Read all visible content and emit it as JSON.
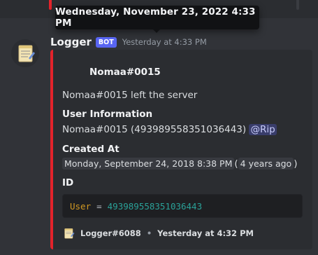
{
  "tooltip": {
    "text": "Wednesday, November 23, 2022 4:33 PM"
  },
  "message": {
    "author": "Logger",
    "bot_tag": "BOT",
    "timestamp": "Yesterday at 4:33 PM",
    "avatar_icon": "notepad-icon"
  },
  "embed": {
    "accent_color": "#e3232b",
    "author": "Nomaa#0015",
    "description": "Nomaa#0015 left the server",
    "fields": [
      {
        "name": "User Information",
        "value_text": "Nomaa#0015 (493989558351036443)",
        "mention": "@Rip"
      },
      {
        "name": "Created At",
        "date": "Monday, September 24, 2018 8:38 PM",
        "relative_open": "(",
        "relative": "4 years ago",
        "relative_close": ")"
      },
      {
        "name": "ID",
        "code_key": "User",
        "code_op": "=",
        "code_value": "493989558351036443"
      }
    ],
    "footer": {
      "text": "Logger#6088",
      "separator": "•",
      "timestamp": "Yesterday at 4:32 PM",
      "icon": "notepad-icon"
    }
  },
  "colors": {
    "background": "#313338",
    "embed_background": "#2b2d31",
    "bot_tag": "#5865f2",
    "code_key": "#d29922",
    "code_value": "#2aa198"
  }
}
